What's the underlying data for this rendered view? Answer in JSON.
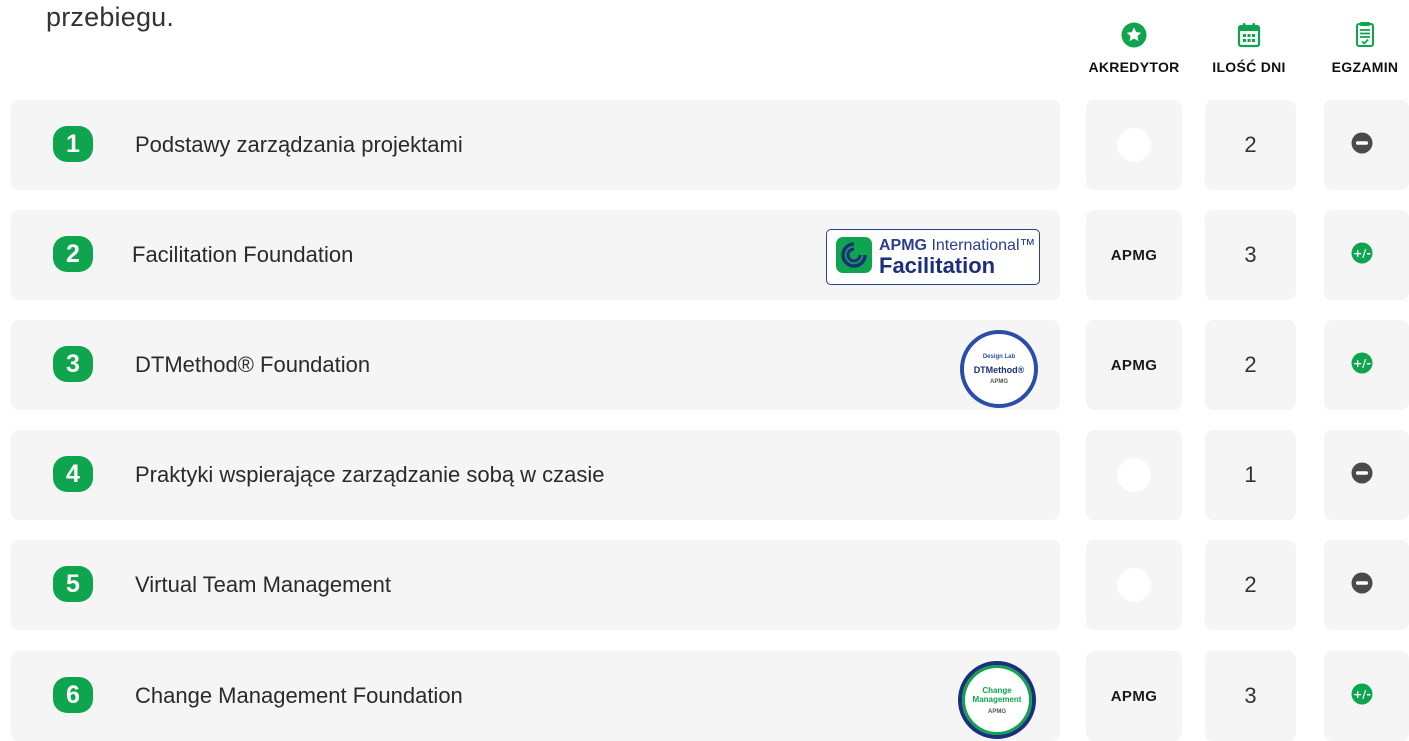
{
  "intro": "przebiegu.",
  "columns": {
    "accreditor": {
      "label": "AKREDYTOR",
      "icon": "star-circle-icon"
    },
    "days": {
      "label": "ILOŚĆ DNI",
      "icon": "calendar-icon"
    },
    "exam": {
      "label": "EGZAMIN",
      "icon": "exam-document-icon"
    }
  },
  "colors": {
    "accent": "#0fa54e",
    "card": "#f5f5f5",
    "minus": "#4a4a4a"
  },
  "courses": [
    {
      "num": "1",
      "title": "Podstawy zarządzania projektami",
      "accreditor": "",
      "days": "2",
      "exam": "minus-icon"
    },
    {
      "num": "2",
      "title": "Facilitation Foundation",
      "accreditor": "APMG",
      "days": "3",
      "exam": "plus-minus-icon",
      "logo": {
        "line1_bold": "APMG",
        "line1_rest": " International™",
        "line2": "Facilitation"
      }
    },
    {
      "num": "3",
      "title": "DTMethod® Foundation",
      "accreditor": "APMG",
      "days": "2",
      "exam": "plus-minus-icon",
      "logo": {
        "top": "Design Lab",
        "main": "DTMethod®",
        "bottom": "APMG"
      }
    },
    {
      "num": "4",
      "title": "Praktyki wspierające zarządzanie sobą w czasie",
      "accreditor": "",
      "days": "1",
      "exam": "minus-icon"
    },
    {
      "num": "5",
      "title": "Virtual Team Management",
      "accreditor": "",
      "days": "2",
      "exam": "minus-icon"
    },
    {
      "num": "6",
      "title": "Change Management Foundation",
      "accreditor": "APMG",
      "days": "3",
      "exam": "plus-minus-icon",
      "logo": {
        "main1": "Change",
        "main2": "Management",
        "bottom": "APMG"
      }
    }
  ]
}
